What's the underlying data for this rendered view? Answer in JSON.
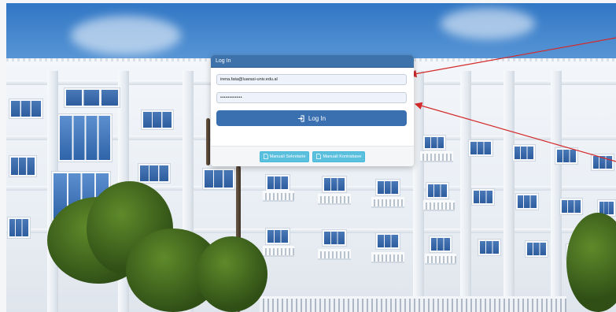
{
  "login": {
    "title": "Log In",
    "email_value": "irena.fata@luarasi-univ.edu.al",
    "password_mask": "••••••••••••",
    "button_label": "Log In",
    "button_icon": "sign-in-icon"
  },
  "footer": {
    "buttons": [
      {
        "label": "Manuali Sekretarie",
        "icon": "document-icon"
      },
      {
        "label": "Manuali Kontrabave",
        "icon": "document-icon"
      }
    ]
  },
  "colors": {
    "header": "#3d72aa",
    "primary_button": "#3a70b0",
    "info_button": "#5bc0de",
    "annotation_arrow": "#d42a2a"
  }
}
